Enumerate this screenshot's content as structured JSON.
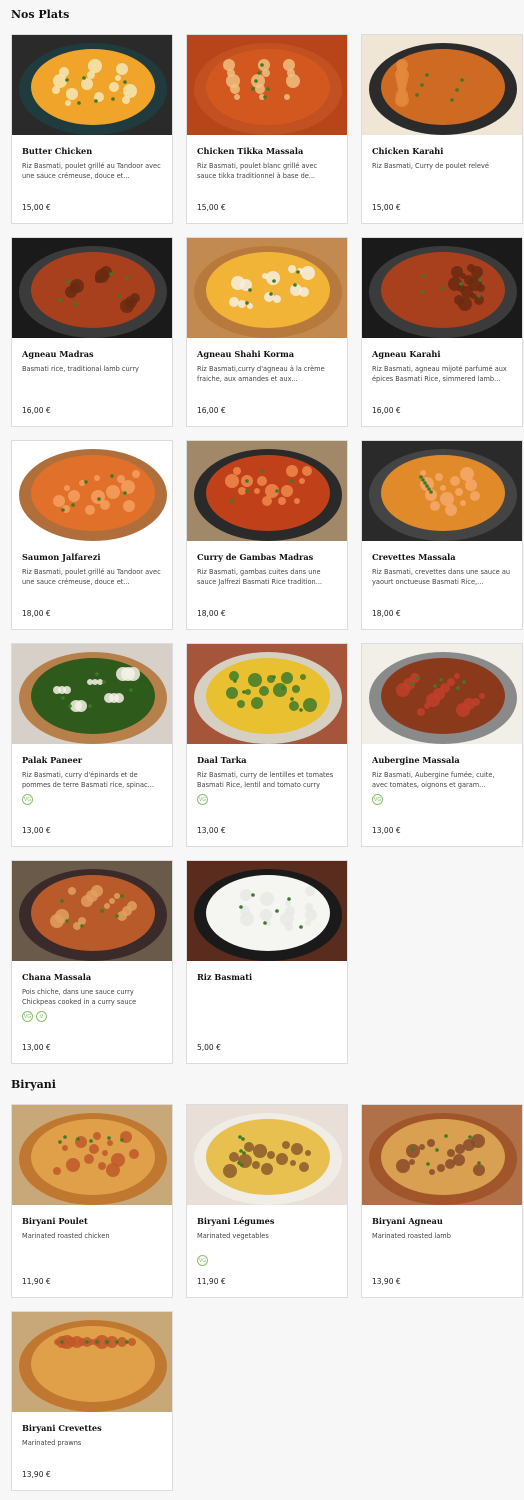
{
  "sections": [
    {
      "title": "Nos Plats"
    },
    {
      "title": "Biryani"
    }
  ],
  "dishes": [
    {
      "name": "Butter Chicken",
      "desc": "Riz Basmati, poulet grillé au Tandoor avec une sauce crémeuse, douce et...",
      "price": "15,00 €",
      "badges": [],
      "photo": "curry-cream"
    },
    {
      "name": "Chicken Tikka Massala",
      "desc": "Riz Basmati, poulet blanc grillé avec sauce tikka traditionnel à base de...",
      "price": "15,00 €",
      "badges": [],
      "photo": "curry-red"
    },
    {
      "name": "Chicken Karahi",
      "desc": "Riz Basmati, Curry de poulet relevé",
      "price": "15,00 €",
      "badges": [],
      "photo": "curry-pan"
    },
    {
      "name": "Agneau Madras",
      "desc": "Basmati rice, traditional lamb curry",
      "price": "16,00 €",
      "badges": [],
      "photo": "curry-dark"
    },
    {
      "name": "Agneau Shahi Korma",
      "desc": "Riz Basmati,curry d'agneau à la crème fraiche, aux amandes et aux...",
      "price": "16,00 €",
      "badges": [],
      "photo": "curry-korma"
    },
    {
      "name": "Agneau Karahi",
      "desc": "Riz Basmati, agneau mijoté parfumé aux épices Basmati Rice, simmered lamb...",
      "price": "16,00 €",
      "badges": [],
      "photo": "curry-dark"
    },
    {
      "name": "Saumon Jalfarezi",
      "desc": "Riz Basmati, poulet grillé au Tandoor avec une sauce crémeuse, douce et...",
      "price": "18,00 €",
      "badges": [],
      "photo": "curry-white"
    },
    {
      "name": "Curry de Gambas Madras",
      "desc": "Riz Basmati, gambas cuites dans une sauce Jalfrezi Basmati Rice tradition...",
      "price": "18,00 €",
      "badges": [],
      "photo": "curry-prawn"
    },
    {
      "name": "Crevettes Massala",
      "desc": " Riz Basmati, crevettes dans une sauce au yaourt onctueuse Basmati Rice,...",
      "price": "18,00 €",
      "badges": [],
      "photo": "curry-prawn2"
    },
    {
      "name": "Palak Paneer",
      "desc": "Riz Basmati, curry d'épinards et de pommes de terre Basmati rice, spinac...",
      "price": "13,00 €",
      "badges": [
        "VG"
      ],
      "photo": "curry-green"
    },
    {
      "name": "Daal Tarka",
      "desc": "Riz Basmati, curry de lentilles et tomates Basmati Rice, lentil and tomato curry",
      "price": "13,00 €",
      "badges": [
        "VG"
      ],
      "photo": "curry-yellow"
    },
    {
      "name": "Aubergine Massala",
      "desc": "Riz Basmati, Aubergine fumée, cuite, avec tomates, oignons et garam...",
      "price": "13,00 €",
      "badges": [
        "VG"
      ],
      "photo": "curry-aubergine"
    },
    {
      "name": "Chana Massala",
      "desc": "Pois chiche, dans une sauce curry Chickpeas cooked in a curry sauce",
      "price": "13,00 €",
      "badges": [
        "VG",
        "V"
      ],
      "photo": "curry-chana"
    },
    {
      "name": "Riz Basmati",
      "desc": "",
      "price": "5,00 €",
      "badges": [],
      "photo": "rice"
    },
    {
      "name": "Biryani Poulet",
      "desc": "Marinated roasted chicken",
      "price": "11,90 €",
      "badges": [],
      "photo": "biryani"
    },
    {
      "name": "Biryani Légumes",
      "desc": "Marinated vegetables",
      "price": "11,90 €",
      "badges": [
        "VG"
      ],
      "photo": "biryani-veg"
    },
    {
      "name": "Biryani Agneau",
      "desc": "Marinated roasted lamb",
      "price": "13,90 €",
      "badges": [],
      "photo": "biryani-lamb"
    },
    {
      "name": "Biryani Crevettes",
      "desc": "Marinated prawns",
      "price": "13,90 €",
      "badges": [],
      "photo": "biryani"
    }
  ]
}
